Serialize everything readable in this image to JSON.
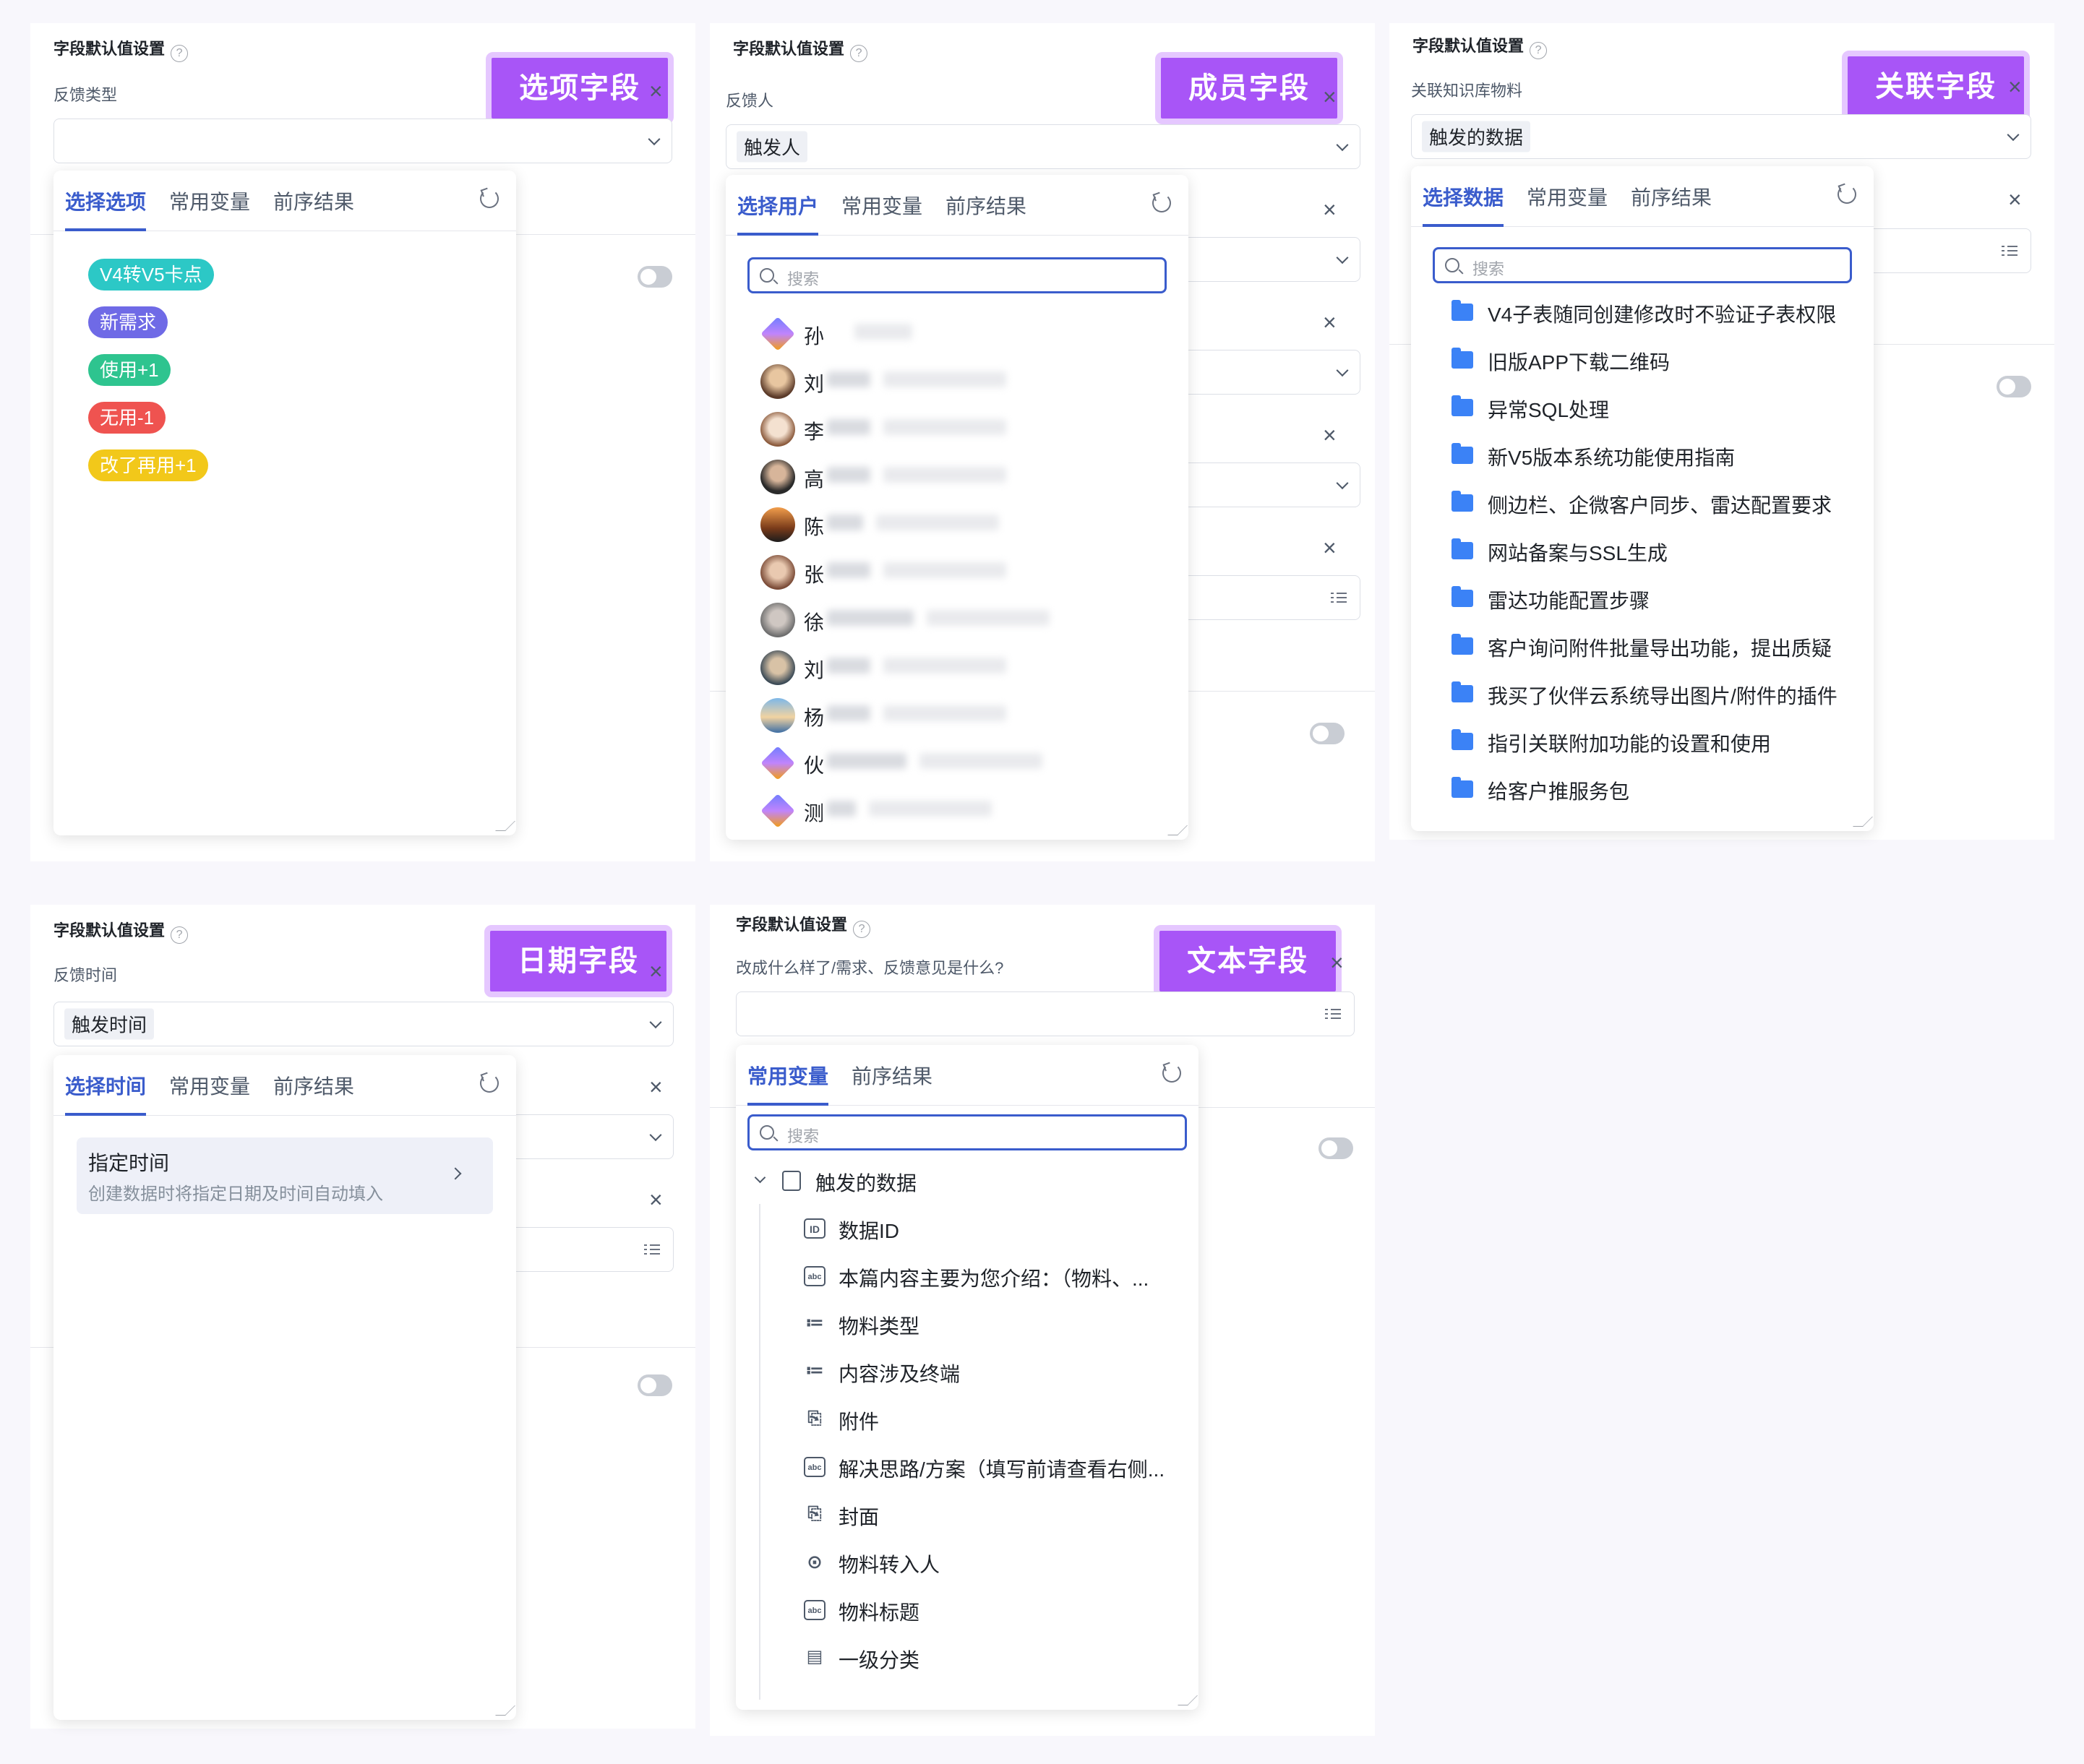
{
  "common": {
    "section_title": "字段默认值设置",
    "help": "?",
    "close": "×",
    "tab_vars": "常用变量",
    "tab_prev": "前序结果",
    "search_placeholder": "搜索"
  },
  "panel1": {
    "badge": "选项字段",
    "label": "反馈类型",
    "tab_active": "选择选项",
    "options": [
      {
        "label": "V4转V5卡点",
        "color": "#2cc8c6"
      },
      {
        "label": "新需求",
        "color": "#6f6ae6"
      },
      {
        "label": "使用+1",
        "color": "#2ec48f"
      },
      {
        "label": "无用-1",
        "color": "#ef5350"
      },
      {
        "label": "改了再用+1",
        "color": "#f2c81a"
      }
    ]
  },
  "panel2": {
    "badge": "成员字段",
    "label": "反馈人",
    "value": "触发人",
    "tab_active": "选择用户",
    "users": [
      "孙",
      "刘",
      "李",
      "高",
      "陈",
      "张",
      "徐",
      "刘",
      "杨",
      "伙",
      "测"
    ]
  },
  "panel3": {
    "badge": "关联字段",
    "label": "关联知识库物料",
    "value": "触发的数据",
    "tab_active": "选择数据",
    "items": [
      "V4子表随同创建修改时不验证子表权限",
      "旧版APP下载二维码",
      "异常SQL处理",
      "新V5版本系统功能使用指南",
      "侧边栏、企微客户同步、雷达配置要求",
      "网站备案与SSL生成",
      "雷达功能配置步骤",
      "客户询问附件批量导出功能，提出质疑",
      "我买了伙伴云系统导出图片/附件的插件",
      "指引关联附加功能的设置和使用",
      "给客户推服务包"
    ]
  },
  "panel4": {
    "badge": "日期字段",
    "label": "反馈时间",
    "value": "触发时间",
    "tab_active": "选择时间",
    "option_title": "指定时间",
    "option_desc": "创建数据时将指定日期及时间自动填入"
  },
  "panel5": {
    "badge": "文本字段",
    "label": "改成什么样了/需求、反馈意见是什么?",
    "tree_root": "触发的数据",
    "tree_items": [
      {
        "icon": "ID",
        "label": "数据ID"
      },
      {
        "icon": "abc",
        "label": "本篇内容主要为您介绍：（物料、..."
      },
      {
        "icon": "≔",
        "label": "物料类型"
      },
      {
        "icon": "≔",
        "label": "内容涉及终端"
      },
      {
        "icon": "⎘",
        "label": "附件"
      },
      {
        "icon": "abc",
        "label": "解决思路/方案（填写前请查看右侧..."
      },
      {
        "icon": "⎘",
        "label": "封面"
      },
      {
        "icon": "⊙",
        "label": "物料转入人"
      },
      {
        "icon": "abc",
        "label": "物料标题"
      },
      {
        "icon": "▤",
        "label": "一级分类"
      }
    ]
  }
}
